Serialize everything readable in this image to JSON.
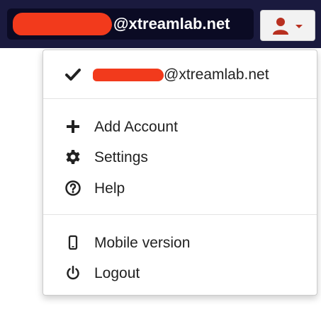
{
  "header": {
    "account_suffix": "@xtreamlab.net",
    "user_icon": "user-icon",
    "dropdown_icon": "chevron-down-icon"
  },
  "menu": {
    "current_account": {
      "icon": "checkmark-icon",
      "suffix": "@xtreamlab.net"
    },
    "items": [
      {
        "icon": "plus-icon",
        "label": "Add Account"
      },
      {
        "icon": "gear-icon",
        "label": "Settings"
      },
      {
        "icon": "help-icon",
        "label": "Help"
      },
      {
        "icon": "mobile-icon",
        "label": "Mobile version"
      },
      {
        "icon": "power-icon",
        "label": "Logout"
      }
    ]
  },
  "colors": {
    "topbar": "#1a1a3e",
    "account_pill": "#0b0b24",
    "redaction": "#f23a1c",
    "user_icon": "#b83020"
  }
}
